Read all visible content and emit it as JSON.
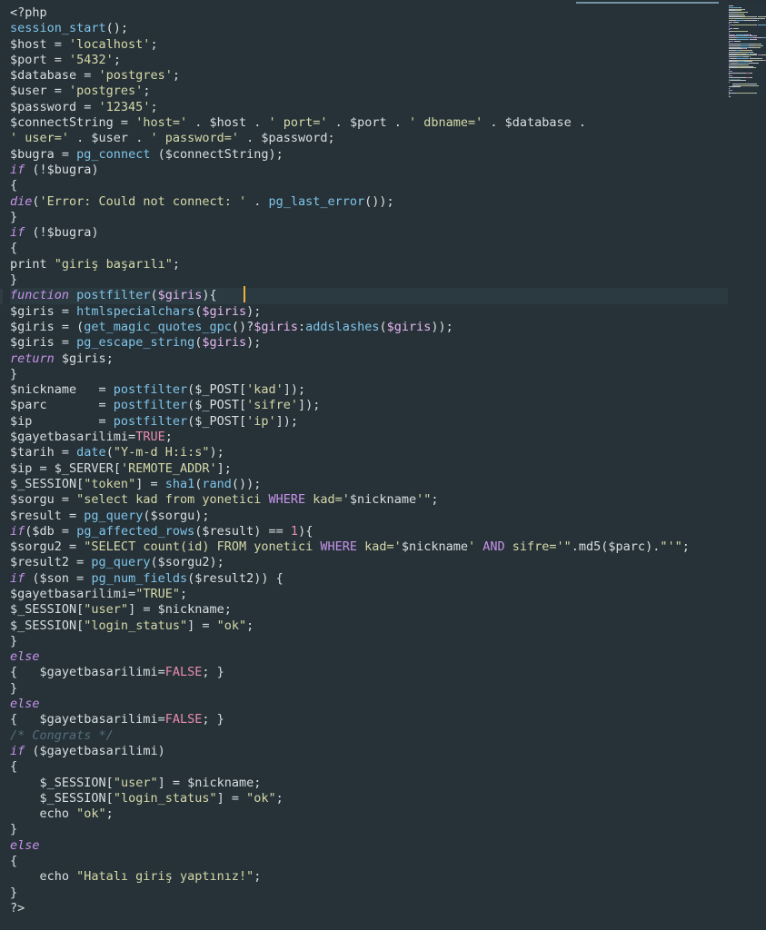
{
  "editor": {
    "language": "php",
    "lines": [
      [
        [
          "<?php",
          "d"
        ]
      ],
      [
        [
          "session_start",
          "c"
        ],
        [
          "();",
          "d"
        ]
      ],
      [
        [
          "$host",
          "d"
        ],
        [
          " = ",
          "p"
        ],
        [
          "'localhost'",
          "s"
        ],
        [
          ";",
          "p"
        ]
      ],
      [
        [
          "$port",
          "d"
        ],
        [
          " = ",
          "p"
        ],
        [
          "'5432'",
          "s"
        ],
        [
          ";",
          "p"
        ]
      ],
      [
        [
          "$database",
          "d"
        ],
        [
          " = ",
          "p"
        ],
        [
          "'postgres'",
          "s"
        ],
        [
          ";",
          "p"
        ]
      ],
      [
        [
          "$user",
          "d"
        ],
        [
          " = ",
          "p"
        ],
        [
          "'postgres'",
          "s"
        ],
        [
          ";",
          "p"
        ]
      ],
      [
        [
          "$password",
          "d"
        ],
        [
          " = ",
          "p"
        ],
        [
          "'12345'",
          "s"
        ],
        [
          ";",
          "p"
        ]
      ],
      [
        [
          "$connectString",
          "d"
        ],
        [
          " = ",
          "p"
        ],
        [
          "'host='",
          "s"
        ],
        [
          " . ",
          "p"
        ],
        [
          "$host",
          "d"
        ],
        [
          " . ",
          "p"
        ],
        [
          "' port='",
          "s"
        ],
        [
          " . ",
          "p"
        ],
        [
          "$port",
          "d"
        ],
        [
          " . ",
          "p"
        ],
        [
          "' dbname='",
          "s"
        ],
        [
          " . ",
          "p"
        ],
        [
          "$database",
          "d"
        ],
        [
          " .",
          "p"
        ]
      ],
      [
        [
          "' user='",
          "s"
        ],
        [
          " . ",
          "p"
        ],
        [
          "$user",
          "d"
        ],
        [
          " . ",
          "p"
        ],
        [
          "' password='",
          "s"
        ],
        [
          " . ",
          "p"
        ],
        [
          "$password",
          "d"
        ],
        [
          ";",
          "p"
        ]
      ],
      [
        [
          "$bugra",
          "d"
        ],
        [
          " = ",
          "p"
        ],
        [
          "pg_connect",
          "c"
        ],
        [
          " (",
          "p"
        ],
        [
          "$connectString",
          "d"
        ],
        [
          ");",
          "p"
        ]
      ],
      [
        [
          "if",
          "k"
        ],
        [
          " (!",
          "p"
        ],
        [
          "$bugra",
          "d"
        ],
        [
          ")",
          "p"
        ]
      ],
      [
        [
          "{",
          "p"
        ]
      ],
      [
        [
          "die",
          "k"
        ],
        [
          "(",
          "p"
        ],
        [
          "'Error: Could not connect: '",
          "s"
        ],
        [
          " . ",
          "p"
        ],
        [
          "pg_last_error",
          "c"
        ],
        [
          "());",
          "p"
        ]
      ],
      [
        [
          "}",
          "p"
        ]
      ],
      [
        [
          "if",
          "k"
        ],
        [
          " (!",
          "p"
        ],
        [
          "$bugra",
          "d"
        ],
        [
          ")",
          "p"
        ]
      ],
      [
        [
          "{",
          "p"
        ]
      ],
      [
        [
          "print ",
          "p"
        ],
        [
          "\"giriş başarılı\"",
          "s"
        ],
        [
          ";",
          "p"
        ]
      ],
      [
        [
          "}",
          "p"
        ]
      ],
      [
        [
          "function",
          "k"
        ],
        [
          " ",
          "p"
        ],
        [
          "postfilter",
          "c"
        ],
        [
          "(",
          "p"
        ],
        [
          "$giris",
          "v"
        ],
        [
          "){",
          "p"
        ]
      ],
      [
        [
          "$giris",
          "d"
        ],
        [
          " = ",
          "p"
        ],
        [
          "htmlspecialchars",
          "c"
        ],
        [
          "(",
          "p"
        ],
        [
          "$giris",
          "v"
        ],
        [
          ");",
          "p"
        ]
      ],
      [
        [
          "$giris",
          "d"
        ],
        [
          " = (",
          "p"
        ],
        [
          "get_magic_quotes_gpc",
          "c"
        ],
        [
          "()?",
          "p"
        ],
        [
          "$giris",
          "v"
        ],
        [
          ":",
          "p"
        ],
        [
          "addslashes",
          "c"
        ],
        [
          "(",
          "p"
        ],
        [
          "$giris",
          "v"
        ],
        [
          "));",
          "p"
        ]
      ],
      [
        [
          "$giris",
          "d"
        ],
        [
          " = ",
          "p"
        ],
        [
          "pg_escape_string",
          "c"
        ],
        [
          "(",
          "p"
        ],
        [
          "$giris",
          "v"
        ],
        [
          ");",
          "p"
        ]
      ],
      [
        [
          "return",
          "k"
        ],
        [
          " ",
          "p"
        ],
        [
          "$giris",
          "d"
        ],
        [
          ";",
          "p"
        ]
      ],
      [
        [
          "}",
          "p"
        ]
      ],
      [
        [
          "$nickname",
          "d"
        ],
        [
          "   = ",
          "p"
        ],
        [
          "postfilter",
          "c"
        ],
        [
          "(",
          "p"
        ],
        [
          "$_POST",
          "d"
        ],
        [
          "[",
          "p"
        ],
        [
          "'kad'",
          "s"
        ],
        [
          "]);",
          "p"
        ]
      ],
      [
        [
          "$parc",
          "d"
        ],
        [
          "       = ",
          "p"
        ],
        [
          "postfilter",
          "c"
        ],
        [
          "(",
          "p"
        ],
        [
          "$_POST",
          "d"
        ],
        [
          "[",
          "p"
        ],
        [
          "'sifre'",
          "s"
        ],
        [
          "]);",
          "p"
        ]
      ],
      [
        [
          "$ip",
          "d"
        ],
        [
          "         = ",
          "p"
        ],
        [
          "postfilter",
          "c"
        ],
        [
          "(",
          "p"
        ],
        [
          "$_POST",
          "d"
        ],
        [
          "[",
          "p"
        ],
        [
          "'ip'",
          "s"
        ],
        [
          "]);",
          "p"
        ]
      ],
      [
        [
          "$gayetbasarilimi",
          "d"
        ],
        [
          "=",
          "p"
        ],
        [
          "TRUE",
          "n"
        ],
        [
          ";",
          "p"
        ]
      ],
      [
        [
          "$tarih",
          "d"
        ],
        [
          " = ",
          "p"
        ],
        [
          "date",
          "c"
        ],
        [
          "(",
          "p"
        ],
        [
          "\"Y-m-d H:i:s\"",
          "s"
        ],
        [
          ");",
          "p"
        ]
      ],
      [
        [
          "$ip",
          "d"
        ],
        [
          " = ",
          "p"
        ],
        [
          "$_SERVER",
          "d"
        ],
        [
          "[",
          "p"
        ],
        [
          "'REMOTE_ADDR'",
          "s"
        ],
        [
          "];",
          "p"
        ]
      ],
      [
        [
          "$_SESSION",
          "d"
        ],
        [
          "[",
          "p"
        ],
        [
          "\"token\"",
          "s"
        ],
        [
          "] = ",
          "p"
        ],
        [
          "sha1",
          "c"
        ],
        [
          "(",
          "p"
        ],
        [
          "rand",
          "c"
        ],
        [
          "());",
          "p"
        ]
      ],
      [
        [
          "$sorgu",
          "d"
        ],
        [
          " = ",
          "p"
        ],
        [
          "\"select kad from yonetici ",
          "s"
        ],
        [
          "WHERE",
          "m"
        ],
        [
          " kad='",
          "s"
        ],
        [
          "$nickname",
          "d"
        ],
        [
          "'\"",
          "s"
        ],
        [
          ";",
          "p"
        ]
      ],
      [
        [
          "$result",
          "d"
        ],
        [
          " = ",
          "p"
        ],
        [
          "pg_query",
          "c"
        ],
        [
          "(",
          "p"
        ],
        [
          "$sorgu",
          "d"
        ],
        [
          ");",
          "p"
        ]
      ],
      [
        [
          "if",
          "k"
        ],
        [
          "(",
          "p"
        ],
        [
          "$db",
          "d"
        ],
        [
          " = ",
          "p"
        ],
        [
          "pg_affected_rows",
          "c"
        ],
        [
          "(",
          "p"
        ],
        [
          "$result",
          "d"
        ],
        [
          ") == ",
          "p"
        ],
        [
          "1",
          "n"
        ],
        [
          "){",
          "p"
        ]
      ],
      [
        [
          "$sorgu2",
          "d"
        ],
        [
          " = ",
          "p"
        ],
        [
          "\"SELECT count(id) FROM yonetici ",
          "s"
        ],
        [
          "WHERE",
          "m"
        ],
        [
          " kad='",
          "s"
        ],
        [
          "$nickname",
          "d"
        ],
        [
          "' ",
          "s"
        ],
        [
          "AND",
          "m"
        ],
        [
          " sifre='\"",
          "s"
        ],
        [
          ".md5(",
          "p"
        ],
        [
          "$parc",
          "d"
        ],
        [
          ").",
          "p"
        ],
        [
          "\"'\"",
          "s"
        ],
        [
          ";",
          "p"
        ]
      ],
      [
        [
          "$result2",
          "d"
        ],
        [
          " = ",
          "p"
        ],
        [
          "pg_query",
          "c"
        ],
        [
          "(",
          "p"
        ],
        [
          "$sorgu2",
          "d"
        ],
        [
          ");",
          "p"
        ]
      ],
      [
        [
          "if",
          "k"
        ],
        [
          " (",
          "p"
        ],
        [
          "$son",
          "d"
        ],
        [
          " = ",
          "p"
        ],
        [
          "pg_num_fields",
          "c"
        ],
        [
          "(",
          "p"
        ],
        [
          "$result2",
          "d"
        ],
        [
          ")) {",
          "p"
        ]
      ],
      [
        [
          "$gayetbasarilimi",
          "d"
        ],
        [
          "=",
          "p"
        ],
        [
          "\"TRUE\"",
          "s"
        ],
        [
          ";",
          "p"
        ]
      ],
      [
        [
          "$_SESSION",
          "d"
        ],
        [
          "[",
          "p"
        ],
        [
          "\"user\"",
          "s"
        ],
        [
          "] = ",
          "p"
        ],
        [
          "$nickname",
          "d"
        ],
        [
          ";",
          "p"
        ]
      ],
      [
        [
          "$_SESSION",
          "d"
        ],
        [
          "[",
          "p"
        ],
        [
          "\"login_status\"",
          "s"
        ],
        [
          "] = ",
          "p"
        ],
        [
          "\"ok\"",
          "s"
        ],
        [
          ";",
          "p"
        ]
      ],
      [
        [
          "}",
          "p"
        ]
      ],
      [
        [
          "else",
          "k"
        ]
      ],
      [
        [
          "{   ",
          "p"
        ],
        [
          "$gayetbasarilimi",
          "d"
        ],
        [
          "=",
          "p"
        ],
        [
          "FALSE",
          "n"
        ],
        [
          "; }",
          "p"
        ]
      ],
      [
        [
          "}",
          "p"
        ]
      ],
      [
        [
          "else",
          "k"
        ]
      ],
      [
        [
          "{   ",
          "p"
        ],
        [
          "$gayetbasarilimi",
          "d"
        ],
        [
          "=",
          "p"
        ],
        [
          "FALSE",
          "n"
        ],
        [
          "; }",
          "p"
        ]
      ],
      [
        [
          "/* Congrats */",
          "o"
        ]
      ],
      [
        [
          "if",
          "k"
        ],
        [
          " (",
          "p"
        ],
        [
          "$gayetbasarilimi",
          "d"
        ],
        [
          ")",
          "p"
        ]
      ],
      [
        [
          "{",
          "p"
        ]
      ],
      [
        [
          "    ",
          "p"
        ],
        [
          "$_SESSION",
          "d"
        ],
        [
          "[",
          "p"
        ],
        [
          "\"user\"",
          "s"
        ],
        [
          "] = ",
          "p"
        ],
        [
          "$nickname",
          "d"
        ],
        [
          ";",
          "p"
        ]
      ],
      [
        [
          "    ",
          "p"
        ],
        [
          "$_SESSION",
          "d"
        ],
        [
          "[",
          "p"
        ],
        [
          "\"login_status\"",
          "s"
        ],
        [
          "] = ",
          "p"
        ],
        [
          "\"ok\"",
          "s"
        ],
        [
          ";",
          "p"
        ]
      ],
      [
        [
          "    echo ",
          "p"
        ],
        [
          "\"ok\"",
          "s"
        ],
        [
          ";",
          "p"
        ]
      ],
      [
        [
          "}",
          "p"
        ]
      ],
      [
        [
          "else",
          "k"
        ]
      ],
      [
        [
          "{",
          "p"
        ]
      ],
      [
        [
          "    echo ",
          "p"
        ],
        [
          "\"Hatalı giriş yaptınız!\"",
          "s"
        ],
        [
          ";",
          "p"
        ]
      ],
      [
        [
          "}",
          "p"
        ]
      ],
      [
        [
          "?>",
          "d"
        ]
      ]
    ],
    "highlight_line": 18
  },
  "colors": {
    "d": "#d9dfe3",
    "p": "#d9dfe3",
    "c": "#7fc4e8",
    "s": "#d6d8a8",
    "k": "#c792ea",
    "n": "#e98bb1",
    "v": "#e9b7f4",
    "m": "#c792ea",
    "o": "#546e7a"
  }
}
